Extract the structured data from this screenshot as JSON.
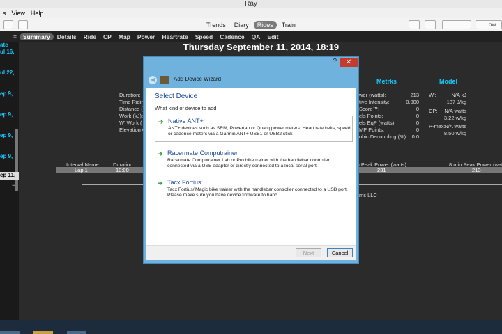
{
  "window": {
    "title": "Ray"
  },
  "menu": {
    "items": [
      "s",
      "View",
      "Help"
    ]
  },
  "toolbar": {
    "view_tabs": [
      "Trends",
      "Diary",
      "Rides",
      "Train"
    ],
    "active_view": "Rides",
    "right_label": "ow"
  },
  "tabs": {
    "items": [
      "Summary",
      "Details",
      "Ride",
      "CP",
      "Map",
      "Power",
      "Heartrate",
      "Speed",
      "Cadence",
      "QA",
      "Edit"
    ],
    "active": "Summary"
  },
  "sidebar": {
    "items": [
      "ate",
      "ul 16,",
      "ul 22,",
      "ep 9,",
      "ep 9,",
      "ep 9,",
      "ep 9,"
    ],
    "selected": "ep 11,"
  },
  "ride": {
    "title": "Thursday September 11, 2014, 18:19",
    "labels_left": [
      "Duration:",
      "Time Ridin",
      "Distance (",
      "Work (kJ):",
      "W' Work (",
      "Elevation G"
    ],
    "metrics_header": "Metrks",
    "metrics": [
      {
        "label": "wer (watts):",
        "value": "213"
      },
      {
        "label": "tive Intensity:",
        "value": "0.000"
      },
      {
        "label": "Score™:",
        "value": "0"
      },
      {
        "label": "els Points:",
        "value": "0"
      },
      {
        "label": "els EqP (watts):",
        "value": "0"
      },
      {
        "label": "MP Points:",
        "value": "0"
      },
      {
        "label": "obic Decoupling (%):",
        "value": "0.0"
      }
    ],
    "model_header": "Model",
    "model": [
      {
        "label": "W':",
        "value": "N/A kJ"
      },
      {
        "label": "",
        "value": "187 J/kg"
      },
      {
        "label": "CP:",
        "value": "N/A watts"
      },
      {
        "label": "",
        "value": "3.22 w/kg"
      },
      {
        "label": "P-max:",
        "value": "N/A watts"
      },
      {
        "label": "",
        "value": "8.50 w/kg"
      }
    ],
    "interval_headers": [
      "Interval Name",
      "Duration",
      "in Peak Power (watts)",
      "8 min Peak Power (watts)"
    ],
    "interval_row": {
      "name": "Lap 1",
      "duration": "10:00",
      "peak": "231",
      "peak8": "213"
    },
    "footer_text": "ms LLC"
  },
  "dialog": {
    "title": "Add Device Wizard",
    "help": "?",
    "close": "✕",
    "heading": "Select Device",
    "question": "What kind of device to add",
    "options": [
      {
        "title": "Native ANT+",
        "desc": "ANT+ devices such as SRM, Powertap or Quarq power meters, Heart rate belts, speed or cadence meters via a Garmin ANT+ USB1 or USB2 stick"
      },
      {
        "title": "Racermate Computrainer",
        "desc": "Racermate Computrainer Lab or Pro bike trainer with the handlebar controller connected via a USB adaptor or directly connected to a local serial port."
      },
      {
        "title": "Tacx Fortius",
        "desc": "Tacx Fortius/iMagic bike trainer with the handlebar controller connected to a USB port. Please make sure you have device firmware to hand."
      }
    ],
    "next_label": "Next",
    "cancel_label": "Cancel"
  }
}
